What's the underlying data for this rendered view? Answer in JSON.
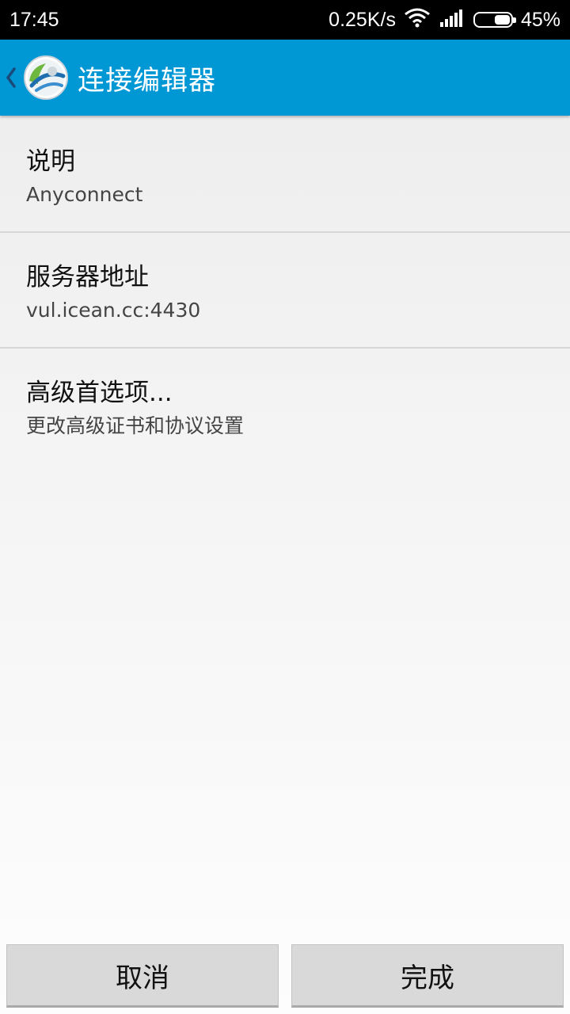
{
  "status_bar": {
    "time": "17:45",
    "net_speed": "0.25K/s",
    "battery_percent": "45%",
    "battery_level": 0.45,
    "icons": [
      "wifi-icon",
      "signal-icon",
      "battery-icon"
    ]
  },
  "app_bar": {
    "title": "连接编辑器",
    "icons": [
      "back-chevron-icon",
      "anyconnect-logo-icon"
    ],
    "color": "#0097d5"
  },
  "items": [
    {
      "title": "说明",
      "subtitle": "Anyconnect"
    },
    {
      "title": "服务器地址",
      "subtitle": "vul.icean.cc:4430"
    },
    {
      "title": "高级首选项...",
      "subtitle": "更改高级证书和协议设置"
    }
  ],
  "buttons": {
    "cancel": "取消",
    "done": "完成"
  }
}
